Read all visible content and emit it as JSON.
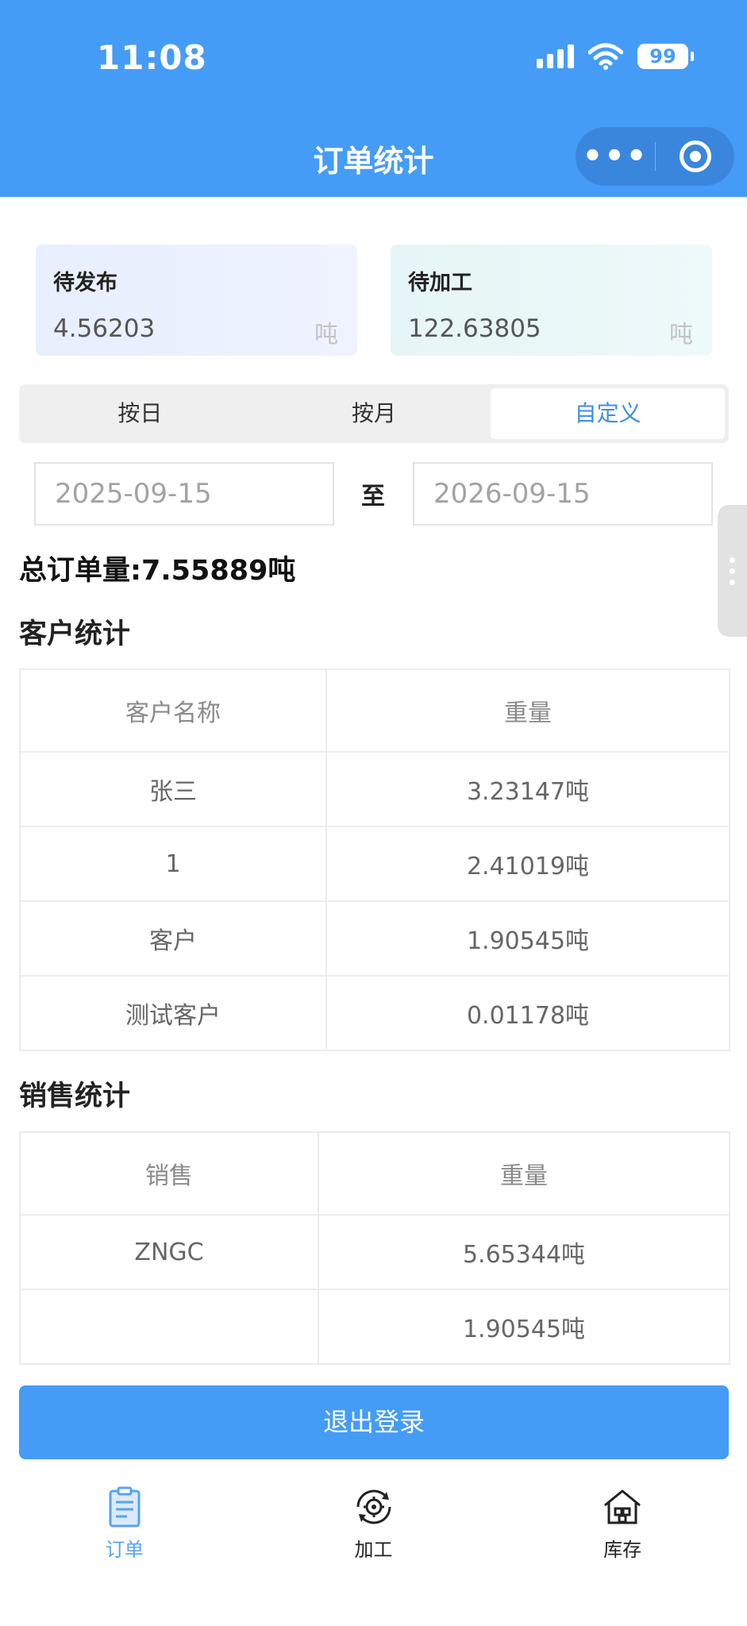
{
  "status_bar": {
    "time": "11:08",
    "battery": "99"
  },
  "nav": {
    "title": "订单统计",
    "more_icon": "more-dots-icon",
    "close_icon": "target-icon"
  },
  "summary": [
    {
      "title": "待发布",
      "value": "4.56203",
      "unit": "吨"
    },
    {
      "title": "待加工",
      "value": "122.63805",
      "unit": "吨"
    }
  ],
  "tabs": [
    {
      "label": "按日",
      "active": false
    },
    {
      "label": "按月",
      "active": false
    },
    {
      "label": "自定义",
      "active": true
    }
  ],
  "date_range": {
    "start": "2025-09-15",
    "separator": "至",
    "end": "2026-09-15"
  },
  "total": "总订单量:7.55889吨",
  "customer_stats": {
    "title": "客户统计",
    "headers": [
      "客户名称",
      "重量"
    ],
    "rows": [
      [
        "张三",
        "3.23147吨"
      ],
      [
        "1",
        "2.41019吨"
      ],
      [
        "客户",
        "1.90545吨"
      ],
      [
        "测试客户",
        "0.01178吨"
      ]
    ]
  },
  "sales_stats": {
    "title": "销售统计",
    "headers": [
      "销售",
      "重量"
    ],
    "rows": [
      [
        "ZNGC",
        "5.65344吨"
      ],
      [
        "",
        "1.90545吨"
      ]
    ]
  },
  "logout_label": "退出登录",
  "tabbar": [
    {
      "label": "订单",
      "icon": "clipboard-icon",
      "active": true
    },
    {
      "label": "加工",
      "icon": "gear-cycle-icon",
      "active": false
    },
    {
      "label": "库存",
      "icon": "warehouse-icon",
      "active": false
    }
  ],
  "colors": {
    "primary": "#459cf6",
    "active_tab_text": "#3c8fe8"
  }
}
